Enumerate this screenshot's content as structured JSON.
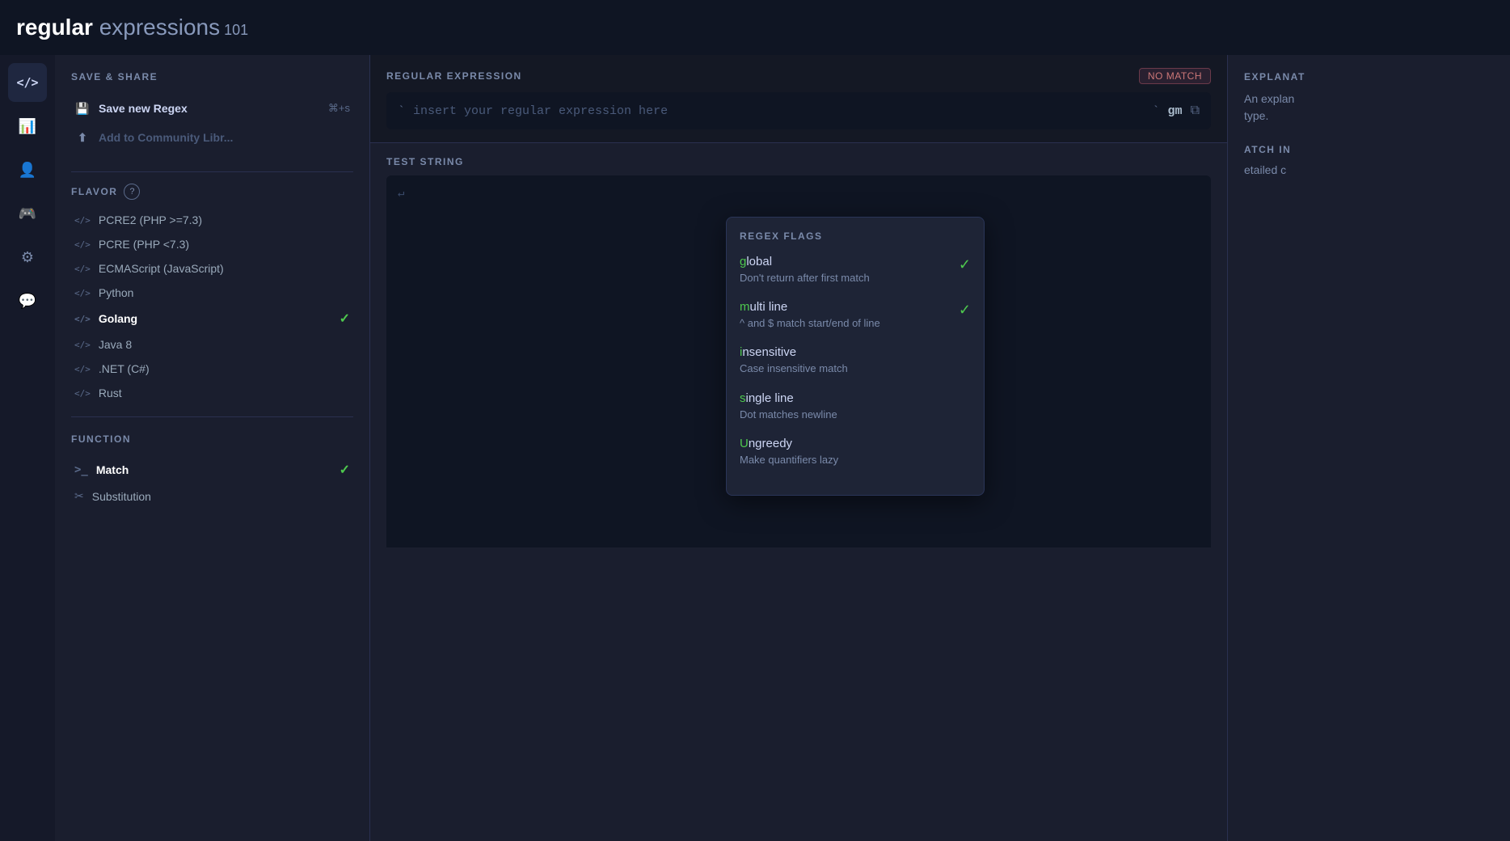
{
  "topbar": {
    "logo_regular": "regular",
    "logo_expressions": " expressions",
    "logo_num": " 101"
  },
  "icon_sidebar": {
    "items": [
      {
        "name": "code-icon",
        "symbol": "</>",
        "active": true
      },
      {
        "name": "chart-icon",
        "symbol": "📊",
        "active": false
      },
      {
        "name": "user-icon",
        "symbol": "👤",
        "active": false
      },
      {
        "name": "gamepad-icon",
        "symbol": "🎮",
        "active": false
      },
      {
        "name": "gear-icon",
        "symbol": "⚙",
        "active": false
      },
      {
        "name": "chat-icon",
        "symbol": "💬",
        "active": false
      }
    ]
  },
  "left_panel": {
    "save_share_title": "SAVE & SHARE",
    "save_new_label": "Save new Regex",
    "save_shortcut": "⌘+s",
    "add_community_label": "Add to Community Libr...",
    "flavor_title": "FLAVOR",
    "flavors": [
      {
        "label": "PCRE2 (PHP >=7.3)",
        "selected": false,
        "check": false
      },
      {
        "label": "PCRE (PHP <7.3)",
        "selected": false,
        "check": false
      },
      {
        "label": "ECMAScript (JavaScript)",
        "selected": false,
        "check": false
      },
      {
        "label": "Python",
        "selected": false,
        "check": false
      },
      {
        "label": "Golang",
        "selected": true,
        "check": true
      },
      {
        "label": "Java 8",
        "selected": false,
        "check": false
      },
      {
        "label": ".NET (C#)",
        "selected": false,
        "check": false
      },
      {
        "label": "Rust",
        "selected": false,
        "check": false
      }
    ],
    "function_title": "FUNCTION",
    "functions": [
      {
        "label": "Match",
        "selected": true,
        "check": true,
        "icon": ">_"
      },
      {
        "label": "Substitution",
        "selected": false,
        "check": false,
        "icon": "✂"
      }
    ]
  },
  "regex_section": {
    "label": "REGULAR EXPRESSION",
    "no_match": "no match",
    "placeholder": "insert your regular expression here",
    "flags": "gm",
    "delimiter_open": "`",
    "delimiter_close": "`"
  },
  "test_string_section": {
    "label": "TEST STRING"
  },
  "flags_dropdown": {
    "title": "REGEX FLAGS",
    "flags": [
      {
        "name": "global",
        "highlight_char": "g",
        "rest": "lobal",
        "description": "Don't return after first match",
        "checked": true
      },
      {
        "name": "multi line",
        "highlight_char": "m",
        "rest": "ulti line",
        "description": "^ and $ match start/end of line",
        "checked": true
      },
      {
        "name": "insensitive",
        "highlight_char": "i",
        "rest": "nsensitive",
        "description": "Case insensitive match",
        "checked": false
      },
      {
        "name": "single line",
        "highlight_char": "s",
        "rest": "ingle line",
        "description": "Dot matches newline",
        "checked": false
      },
      {
        "name": "Ungreedy",
        "highlight_char": "U",
        "rest": "ngreedy",
        "description": "Make quantifiers lazy",
        "checked": false
      }
    ]
  },
  "explanation": {
    "title": "EXPLANAT",
    "text": "An explan type.",
    "match_info_title": "ATCH IN",
    "match_info_text": "etailed c"
  }
}
